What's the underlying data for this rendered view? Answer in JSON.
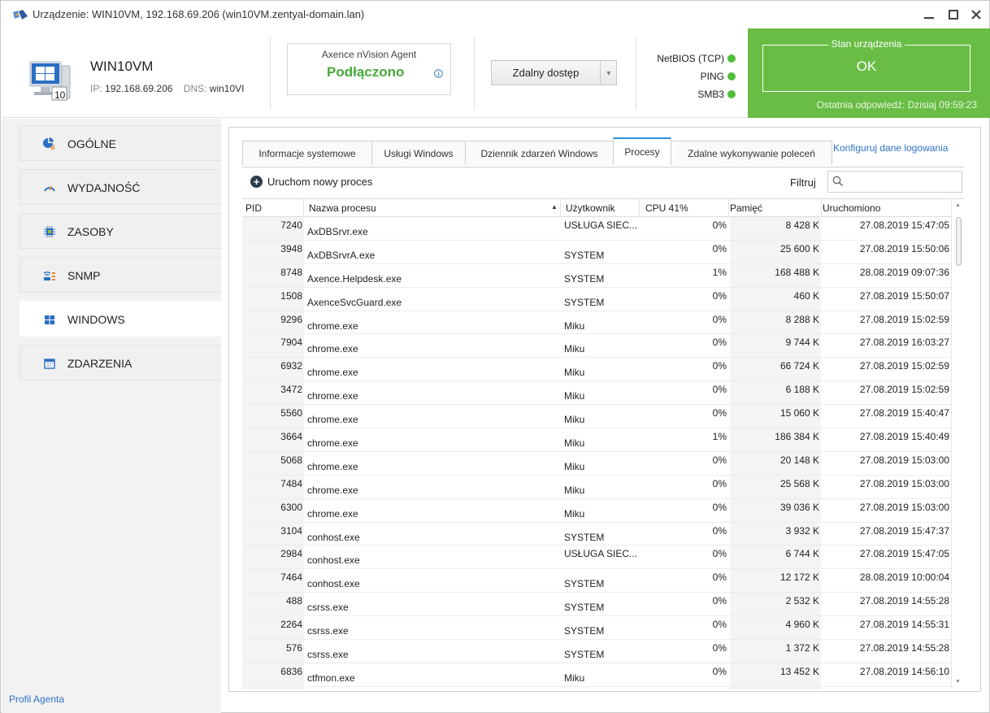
{
  "window": {
    "title": "Urządzenie: WIN10VM, 192.168.69.206 (win10VM.zentyal-domain.lan)"
  },
  "device": {
    "name": "WIN10VM",
    "ip_label": "IP:",
    "ip": "192.168.69.206",
    "dns_label": "DNS:",
    "dns": "win10VI"
  },
  "agent": {
    "label": "Axence nVision Agent",
    "status": "Podłączono",
    "status_color": "#48a93a"
  },
  "remote": {
    "label": "Zdalny dostęp"
  },
  "services": [
    {
      "name": "NetBIOS (TCP)",
      "status_color": "#4fbf3a"
    },
    {
      "name": "PING",
      "status_color": "#4fbf3a"
    },
    {
      "name": "SMB3",
      "status_color": "#4fbf3a"
    }
  ],
  "state": {
    "legend": "Stan urządzenia",
    "value": "OK",
    "last_response": "Ostatnia odpowiedź: Dzisiaj 09:59:23",
    "color": "#69bd45"
  },
  "sidebar": {
    "items": [
      {
        "label": "OGÓLNE",
        "icon": "chart-pie-icon"
      },
      {
        "label": "WYDAJNOŚĆ",
        "icon": "gauge-icon"
      },
      {
        "label": "ZASOBY",
        "icon": "chip-icon"
      },
      {
        "label": "SNMP",
        "icon": "snmp-icon"
      },
      {
        "label": "WINDOWS",
        "icon": "windows-icon",
        "active": true
      },
      {
        "label": "ZDARZENIA",
        "icon": "calendar-icon"
      }
    ],
    "profile_link": "Profil Agenta"
  },
  "tabs": [
    {
      "label": "Informacje systemowe"
    },
    {
      "label": "Usługi Windows"
    },
    {
      "label": "Dziennik zdarzeń Windows"
    },
    {
      "label": "Procesy",
      "active": true
    },
    {
      "label": "Zdalne wykonywanie poleceń"
    }
  ],
  "config_link": "Konfiguruj dane logowania",
  "toolbar": {
    "new_process": "Uruchom nowy proces",
    "filter_label": "Filtruj",
    "filter_value": ""
  },
  "table": {
    "columns": [
      "PID",
      "Nazwa procesu",
      "Użytkownik",
      "CPU 41%",
      "Pamięć",
      "Uruchomiono"
    ],
    "sort_column": "Nazwa procesu",
    "sort_dir": "asc",
    "rows": [
      {
        "pid": "7240",
        "name": "AxDBSrvr.exe",
        "user": "USŁUGA SIEC...",
        "cpu": "0%",
        "mem": "8 428 K",
        "start": "27.08.2019 15:47:05"
      },
      {
        "pid": "3948",
        "name": "AxDBSrvrA.exe",
        "user": "SYSTEM",
        "cpu": "0%",
        "mem": "25 600 K",
        "start": "27.08.2019 15:50:06"
      },
      {
        "pid": "8748",
        "name": "Axence.Helpdesk.exe",
        "user": "SYSTEM",
        "cpu": "1%",
        "mem": "168 488 K",
        "start": "28.08.2019 09:07:36"
      },
      {
        "pid": "1508",
        "name": "AxenceSvcGuard.exe",
        "user": "SYSTEM",
        "cpu": "0%",
        "mem": "460 K",
        "start": "27.08.2019 15:50:07"
      },
      {
        "pid": "9296",
        "name": "chrome.exe",
        "user": "Miku",
        "cpu": "0%",
        "mem": "8 288 K",
        "start": "27.08.2019 15:02:59"
      },
      {
        "pid": "7904",
        "name": "chrome.exe",
        "user": "Miku",
        "cpu": "0%",
        "mem": "9 744 K",
        "start": "27.08.2019 16:03:27"
      },
      {
        "pid": "6932",
        "name": "chrome.exe",
        "user": "Miku",
        "cpu": "0%",
        "mem": "66 724 K",
        "start": "27.08.2019 15:02:59"
      },
      {
        "pid": "3472",
        "name": "chrome.exe",
        "user": "Miku",
        "cpu": "0%",
        "mem": "6 188 K",
        "start": "27.08.2019 15:02:59"
      },
      {
        "pid": "5560",
        "name": "chrome.exe",
        "user": "Miku",
        "cpu": "0%",
        "mem": "15 060 K",
        "start": "27.08.2019 15:40:47"
      },
      {
        "pid": "3664",
        "name": "chrome.exe",
        "user": "Miku",
        "cpu": "1%",
        "mem": "186 384 K",
        "start": "27.08.2019 15:40:49"
      },
      {
        "pid": "5068",
        "name": "chrome.exe",
        "user": "Miku",
        "cpu": "0%",
        "mem": "20 148 K",
        "start": "27.08.2019 15:03:00"
      },
      {
        "pid": "7484",
        "name": "chrome.exe",
        "user": "Miku",
        "cpu": "0%",
        "mem": "25 568 K",
        "start": "27.08.2019 15:03:00"
      },
      {
        "pid": "6300",
        "name": "chrome.exe",
        "user": "Miku",
        "cpu": "0%",
        "mem": "39 036 K",
        "start": "27.08.2019 15:03:00"
      },
      {
        "pid": "3104",
        "name": "conhost.exe",
        "user": "SYSTEM",
        "cpu": "0%",
        "mem": "3 932 K",
        "start": "27.08.2019 15:47:37"
      },
      {
        "pid": "2984",
        "name": "conhost.exe",
        "user": "USŁUGA SIEC...",
        "cpu": "0%",
        "mem": "6 744 K",
        "start": "27.08.2019 15:47:05"
      },
      {
        "pid": "7464",
        "name": "conhost.exe",
        "user": "SYSTEM",
        "cpu": "0%",
        "mem": "12 172 K",
        "start": "28.08.2019 10:00:04"
      },
      {
        "pid": "488",
        "name": "csrss.exe",
        "user": "SYSTEM",
        "cpu": "0%",
        "mem": "2 532 K",
        "start": "27.08.2019 14:55:28"
      },
      {
        "pid": "2264",
        "name": "csrss.exe",
        "user": "SYSTEM",
        "cpu": "0%",
        "mem": "4 960 K",
        "start": "27.08.2019 14:55:31"
      },
      {
        "pid": "576",
        "name": "csrss.exe",
        "user": "SYSTEM",
        "cpu": "0%",
        "mem": "1 372 K",
        "start": "27.08.2019 14:55:28"
      },
      {
        "pid": "6836",
        "name": "ctfmon.exe",
        "user": "Miku",
        "cpu": "0%",
        "mem": "13 452 K",
        "start": "27.08.2019 14:56:10"
      }
    ]
  }
}
